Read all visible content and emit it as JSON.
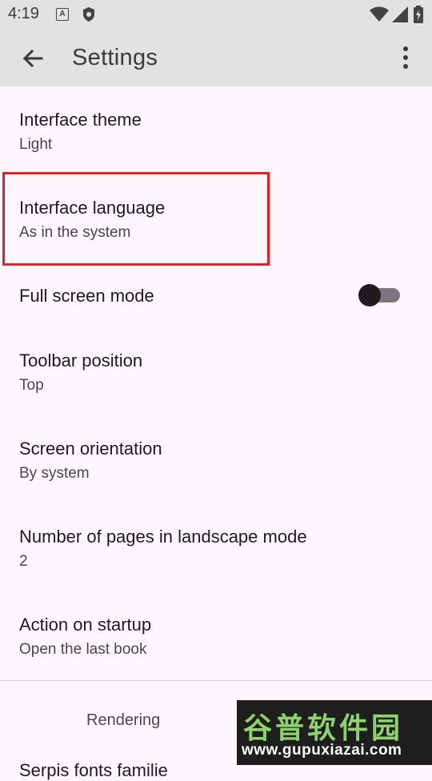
{
  "status_bar": {
    "time": "4:19",
    "icons": [
      "a-notification-icon",
      "shield-icon",
      "wifi-icon",
      "signal-icon",
      "battery-charging-icon"
    ]
  },
  "app_bar": {
    "title": "Settings",
    "back_icon": "arrow-back-icon",
    "overflow_icon": "more-vert-icon"
  },
  "settings": [
    {
      "title": "Interface theme",
      "summary": "Light"
    },
    {
      "title": "Interface language",
      "summary": "As in the system"
    },
    {
      "title": "Full screen mode",
      "toggle_on": false
    },
    {
      "title": "Toolbar position",
      "summary": "Top"
    },
    {
      "title": "Screen orientation",
      "summary": "By system"
    },
    {
      "title": "Number of pages in landscape mode",
      "summary": "2"
    },
    {
      "title": "Action on startup",
      "summary": "Open the last book"
    }
  ],
  "section": {
    "header": "Rendering"
  },
  "partial_item": {
    "title": "Serpis fonts familie"
  },
  "watermark": {
    "main": "谷普软件园",
    "url": "www.gupuxiazai.com"
  },
  "colors": {
    "background": "#fdf7fd",
    "bar": "#e2e2e2",
    "highlight": "#e0202c",
    "watermark_green": "#8dd26a"
  }
}
